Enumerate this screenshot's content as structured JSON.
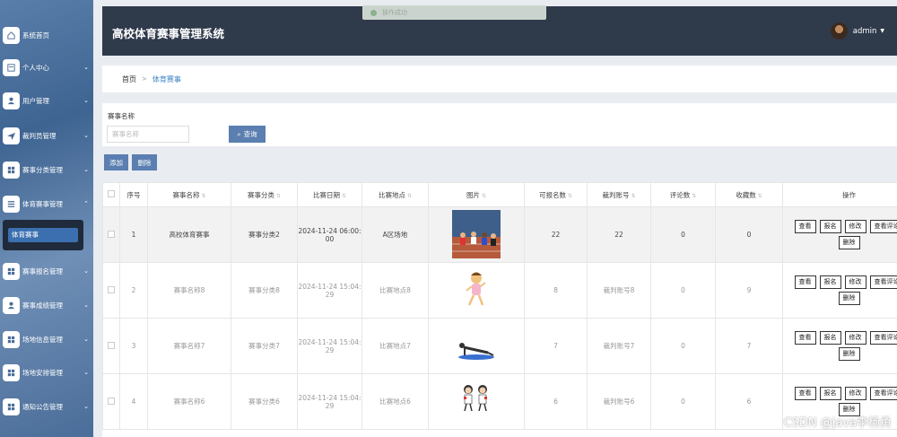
{
  "app": {
    "title": "高校体育赛事管理系统",
    "user": "admin",
    "toast": "操作成功"
  },
  "sidebar": {
    "items": [
      {
        "label": "系统首页",
        "icon": "home-icon",
        "arrow": false
      },
      {
        "label": "个人中心",
        "icon": "profile-icon",
        "arrow": true
      },
      {
        "label": "用户管理",
        "icon": "user-icon",
        "arrow": true
      },
      {
        "label": "裁判员管理",
        "icon": "send-icon",
        "arrow": true
      },
      {
        "label": "赛事分类管理",
        "icon": "grid-icon",
        "arrow": true
      },
      {
        "label": "体育赛事管理",
        "icon": "list-icon",
        "arrow": true,
        "expanded": true
      },
      {
        "label": "赛事报名管理",
        "icon": "grid-icon",
        "arrow": true
      },
      {
        "label": "赛事成绩管理",
        "icon": "person-icon",
        "arrow": true
      },
      {
        "label": "场地信息管理",
        "icon": "grid-icon",
        "arrow": true
      },
      {
        "label": "场地安排管理",
        "icon": "grid-icon",
        "arrow": true
      },
      {
        "label": "通知公告管理",
        "icon": "grid-icon",
        "arrow": true
      }
    ],
    "submenu": {
      "label": "体育赛事"
    }
  },
  "breadcrumb": {
    "home": "首页",
    "sep": ">",
    "current": "体育赛事"
  },
  "search": {
    "label": "赛事名称",
    "placeholder": "赛事名称",
    "button": "查询"
  },
  "actions": {
    "add": "添加",
    "delete": "删除"
  },
  "table": {
    "headers": [
      "序号",
      "赛事名称",
      "赛事分类",
      "比赛日期",
      "比赛地点",
      "图片",
      "可报名数",
      "裁判账号",
      "评论数",
      "收藏数",
      "操作"
    ],
    "op_labels": [
      "查看",
      "报名",
      "修改",
      "查看评论",
      "删除"
    ],
    "rows": [
      {
        "no": "1",
        "name": "高校体育赛事",
        "category": "赛事分类2",
        "date": "2024-11-24 06:00:00",
        "place": "A区场地",
        "image": "sprint-race",
        "quota": "22",
        "referee": "22",
        "comments": "0",
        "favorites": "0"
      },
      {
        "no": "2",
        "name": "赛事名称8",
        "category": "赛事分类8",
        "date": "2024-11-24 15:04:29",
        "place": "比赛地点8",
        "image": "runner-girl",
        "quota": "8",
        "referee": "裁判账号8",
        "comments": "0",
        "favorites": "9"
      },
      {
        "no": "3",
        "name": "赛事名称7",
        "category": "赛事分类7",
        "date": "2024-11-24 15:04:29",
        "place": "比赛地点7",
        "image": "pushup",
        "quota": "7",
        "referee": "裁判账号7",
        "comments": "0",
        "favorites": "7"
      },
      {
        "no": "4",
        "name": "赛事名称6",
        "category": "赛事分类6",
        "date": "2024-11-24 15:04:29",
        "place": "比赛地点6",
        "image": "kids-run",
        "quota": "6",
        "referee": "裁判账号6",
        "comments": "0",
        "favorites": "6"
      }
    ]
  },
  "watermark": "CSDN @java李杨勇",
  "colors": {
    "sidebar": "#4a6d99",
    "header": "#2f3a4b",
    "accent": "#5a7fb0",
    "link": "#3b82c4"
  }
}
